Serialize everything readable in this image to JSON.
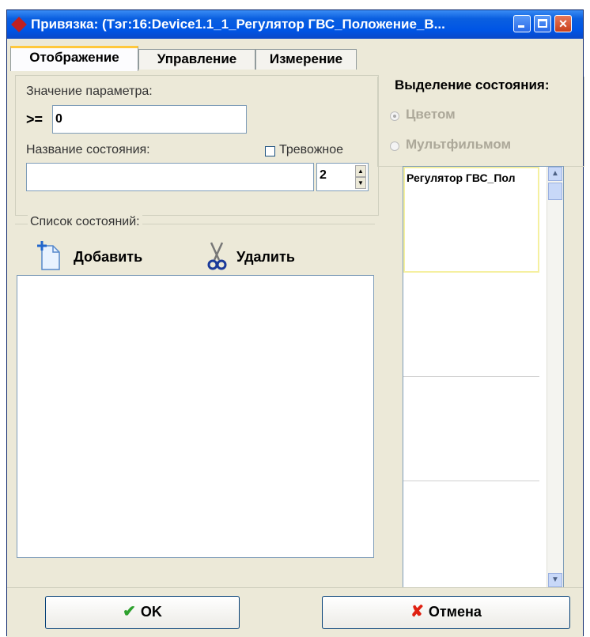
{
  "window": {
    "title": "Привязка: (Тэг:16:Device1.1_1_Регулятор ГВС_Положение_В...",
    "controls": {
      "minimize": "minimize-icon",
      "maximize": "maximize-icon",
      "close": "close-icon"
    }
  },
  "tabs": [
    {
      "label": "Отображение",
      "active": true
    },
    {
      "label": "Управление",
      "active": false
    },
    {
      "label": "Измерение",
      "active": false
    }
  ],
  "param": {
    "label": "Значение параметра:",
    "operator": ">=",
    "value": "0"
  },
  "state": {
    "label": "Название состояния:",
    "name_value": "",
    "alarm_label": "Тревожное",
    "alarm_checked": false,
    "spin_value": "2"
  },
  "highlight": {
    "title": "Выделение состояния:",
    "options": [
      {
        "label": "Цветом",
        "checked": true,
        "enabled": false
      },
      {
        "label": "Мультфильмом",
        "checked": false,
        "enabled": false
      }
    ]
  },
  "states_list": {
    "title": "Список состояний:",
    "add_label": "Добавить",
    "delete_label": "Удалить",
    "items": []
  },
  "preview": {
    "cells": [
      {
        "label": "Регулятор ГВС_Пол",
        "selected": true
      },
      {
        "label": "",
        "selected": false
      },
      {
        "label": "",
        "selected": false
      },
      {
        "label": "",
        "selected": false
      }
    ]
  },
  "buttons": {
    "ok": "OK",
    "cancel": "Отмена"
  },
  "colors": {
    "title_bar": "#0055e5",
    "face": "#ece9d8",
    "ok_check": "#2ea12e",
    "cancel_x": "#e02010",
    "tab_accent": "#ffc83c"
  }
}
